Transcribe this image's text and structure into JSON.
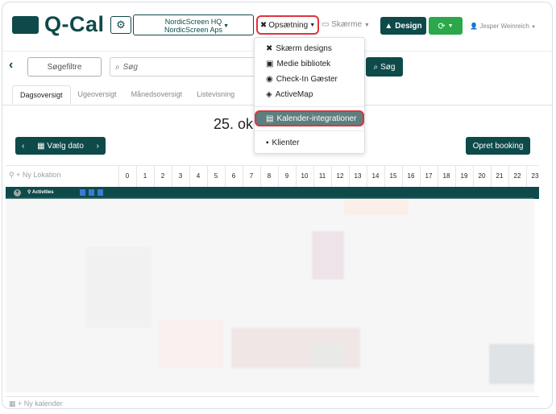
{
  "app": {
    "name": "Q-Cal"
  },
  "header": {
    "org_name": "NordicScreen HQ",
    "org_sub": "NordicScreen Aps",
    "menu_setup": "Opsætning",
    "menu_screens": "Skærme",
    "design_label": "Design",
    "user_name": "Jesper Weinreich",
    "colors": {
      "primary": "#0e4a4a",
      "sync": "#2aa84a",
      "highlight": "#e0343b"
    }
  },
  "dropdown": {
    "items": [
      {
        "label": "Skærm designs",
        "icon": "tools-icon"
      },
      {
        "label": "Medie bibliotek",
        "icon": "images-icon"
      },
      {
        "label": "Check-In Gæster",
        "icon": "dashboard-icon"
      },
      {
        "label": "ActiveMap",
        "icon": "map-icon"
      },
      {
        "label": "Kalender-integrationer",
        "icon": "calendar-plug-icon",
        "highlighted": true
      },
      {
        "label": "Klienter",
        "icon": "contact-icon"
      }
    ]
  },
  "toolbar": {
    "filter_label": "Søgefiltre",
    "search_placeholder": "Søg",
    "search_button": "Søg"
  },
  "tabs": [
    "Dagsoversigt",
    "Ugeoversigt",
    "Månedsoversigt",
    "Listevisning"
  ],
  "active_tab": "Dagsoversigt",
  "day": {
    "title": "25. ok",
    "pick_date": "Vælg dato",
    "new_booking": "Opret booking"
  },
  "grid": {
    "new_location": "Ny Lokation",
    "hours": [
      "0",
      "1",
      "2",
      "3",
      "4",
      "5",
      "6",
      "7",
      "8",
      "9",
      "10",
      "11",
      "12",
      "13",
      "14",
      "15",
      "16",
      "17",
      "18",
      "19",
      "20",
      "21",
      "22",
      "23"
    ],
    "activities_label": "Activities",
    "new_calendar": "Ny kalender"
  }
}
